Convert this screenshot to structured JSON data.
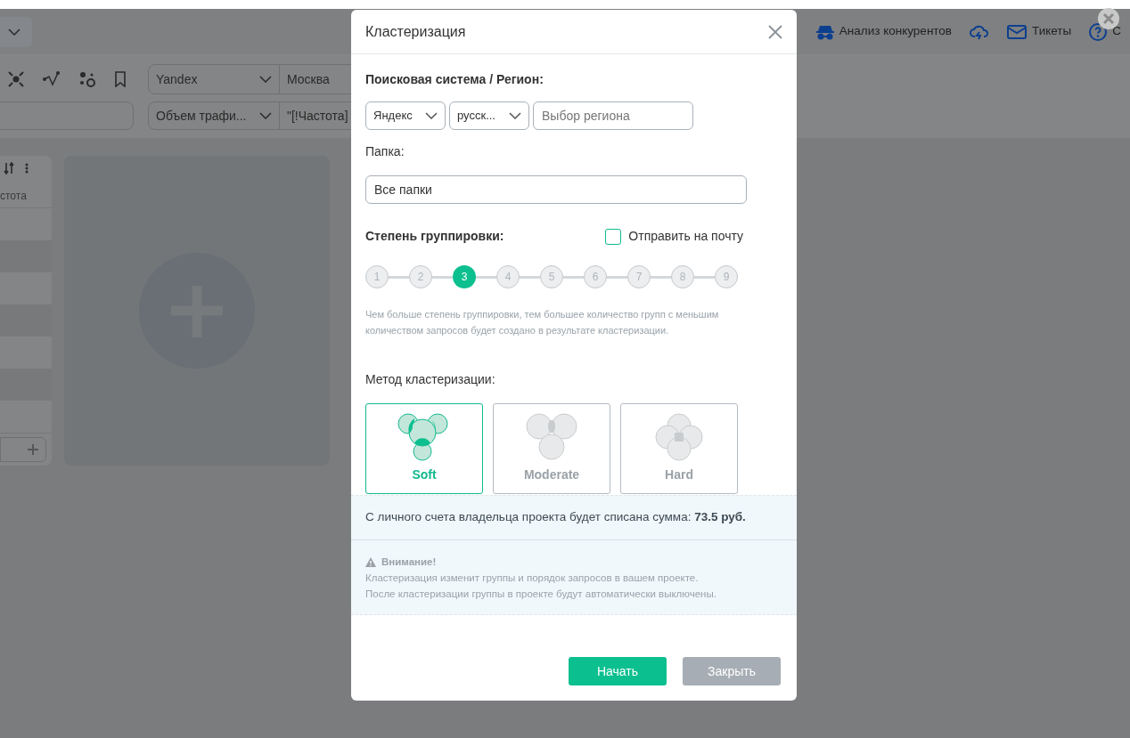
{
  "header": {
    "links": [
      {
        "label": "Анализ конкурентов",
        "kind": "spy"
      },
      {
        "kind": "cloud"
      },
      {
        "label": "Тикеты",
        "kind": "mail"
      },
      {
        "label": "С",
        "kind": "help"
      }
    ]
  },
  "toolbar": {
    "search_engine": "Yandex",
    "region": "Москва",
    "metric": "Объем трафи...",
    "formula": "\"[!Частота]"
  },
  "table": {
    "column_header": "стота"
  },
  "modal": {
    "title": "Кластеризация",
    "engine_label": "Поисковая система / Регион:",
    "engine": "Яндекс",
    "language": "русск...",
    "region_placeholder": "Выбор региона",
    "folder_label": "Папка:",
    "folder": "Все папки",
    "grouping_label": "Степень группировки:",
    "email_checkbox": {
      "label": "Отправить на почту",
      "checked": false
    },
    "steps": [
      {
        "label": "1",
        "selected": false
      },
      {
        "label": "2",
        "selected": false
      },
      {
        "label": "3",
        "selected": true
      },
      {
        "label": "4",
        "selected": false
      },
      {
        "label": "5",
        "selected": false
      },
      {
        "label": "6",
        "selected": false
      },
      {
        "label": "7",
        "selected": false
      },
      {
        "label": "8",
        "selected": false
      },
      {
        "label": "9",
        "selected": false
      }
    ],
    "grouping_hint": "Чем больше степень группировки, тем большее количество групп с меньшим количеством запросов будет создано в результате кластеризации.",
    "method_label": "Метод кластеризации:",
    "methods": [
      {
        "label": "Soft",
        "kind": "soft",
        "selected": true
      },
      {
        "label": "Moderate",
        "kind": "moderate",
        "selected": false
      },
      {
        "label": "Hard",
        "kind": "hard",
        "selected": false
      }
    ],
    "cost_text": "С личного счета владельца проекта будет списана сумма: **73.5 руб.**",
    "warning_title": "Внимание!",
    "warning_lines": [
      "Кластеризация изменит группы и порядок запросов в вашем проекте.",
      "После кластеризации группы в проекте будут автоматически выключены."
    ],
    "buttons": [
      {
        "label": "Начать",
        "kind": "primary"
      },
      {
        "label": "Закрыть",
        "kind": "secondary"
      }
    ]
  }
}
